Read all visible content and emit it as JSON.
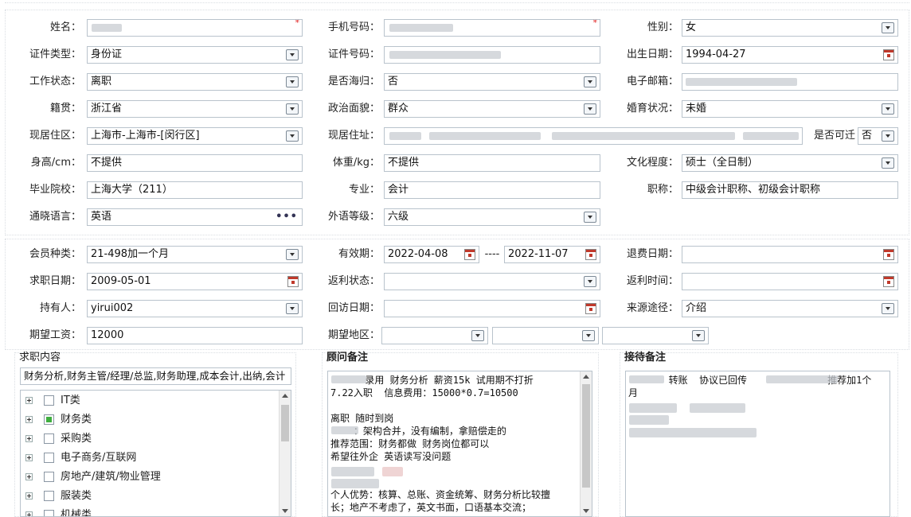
{
  "personal": {
    "name": {
      "label": "姓名："
    },
    "phone": {
      "label": "手机号码："
    },
    "gender": {
      "label": "性别：",
      "value": "女"
    },
    "id_type": {
      "label": "证件类型：",
      "value": "身份证"
    },
    "id_number": {
      "label": "证件号码："
    },
    "birth_date": {
      "label": "出生日期：",
      "value": "1994-04-27"
    },
    "work_status": {
      "label": "工作状态：",
      "value": "离职"
    },
    "returnee": {
      "label": "是否海归：",
      "value": "否"
    },
    "email": {
      "label": "电子邮箱："
    },
    "native_place": {
      "label": "籍贯：",
      "value": "浙江省"
    },
    "political": {
      "label": "政治面貌：",
      "value": "群众"
    },
    "marital": {
      "label": "婚育状况：",
      "value": "未婚"
    },
    "residence_area": {
      "label": "现居住区：",
      "value": "上海市-上海市-[闵行区]"
    },
    "address": {
      "label": "现居住址："
    },
    "relocate": {
      "label": "是否可迁",
      "value": "否"
    },
    "height": {
      "label": "身高/cm：",
      "value": "不提供"
    },
    "weight": {
      "label": "体重/kg：",
      "value": "不提供"
    },
    "education": {
      "label": "文化程度：",
      "value": "硕士（全日制）"
    },
    "school": {
      "label": "毕业院校：",
      "value": "上海大学（211）"
    },
    "major": {
      "label": "专业：",
      "value": "会计"
    },
    "title": {
      "label": "职称：",
      "value": "中级会计职称、初级会计职称"
    },
    "language": {
      "label": "通晓语言：",
      "value": "英语"
    },
    "language_level": {
      "label": "外语等级：",
      "value": "六级"
    }
  },
  "membership": {
    "member_type": {
      "label": "会员种类：",
      "value": "21-498加一个月"
    },
    "valid_period": {
      "label": "有效期：",
      "start": "2022-04-08",
      "separator": "----",
      "end": "2022-11-07"
    },
    "refund_date": {
      "label": "退费日期："
    },
    "job_date": {
      "label": "求职日期：",
      "value": "2009-05-01"
    },
    "rebate_status": {
      "label": "返利状态："
    },
    "rebate_time": {
      "label": "返利时间："
    },
    "holder": {
      "label": "持有人：",
      "value": "yirui002"
    },
    "visit_date": {
      "label": "回访日期："
    },
    "source": {
      "label": "来源途径：",
      "value": "介绍"
    },
    "salary": {
      "label": "期望工资：",
      "value": "12000"
    },
    "region": {
      "label": "期望地区："
    }
  },
  "job_content": {
    "title": "求职内容",
    "summary": "财务分析,财务主管/经理/总监,财务助理,成本会计,出纳,会计",
    "categories": [
      {
        "label": "IT类",
        "checked": false
      },
      {
        "label": "财务类",
        "checked": true
      },
      {
        "label": "采购类",
        "checked": false
      },
      {
        "label": "电子商务/互联网",
        "checked": false
      },
      {
        "label": "房地产/建筑/物业管理",
        "checked": false
      },
      {
        "label": "服装类",
        "checked": false
      },
      {
        "label": "机械类",
        "checked": false
      }
    ]
  },
  "consultant_notes": {
    "title": "顾问备注",
    "lines": [
      "      录用 财务分析 薪资15k 试用期不打折",
      "7.22入职  信息费用：15000*0.7=10500",
      "",
      "离职 随时到岗",
      "    ：架构合并，没有编制，拿赔偿走的",
      "推荐范围：财务都做 财务岗位都可以",
      "希望往外企 英语读写没问题",
      "",
      "",
      "个人优势：核算、总账、资金统筹、财务分析比较擅",
      "长；地产不考虑了，英文书面，口语基本交流；"
    ]
  },
  "reception_notes": {
    "title": "接待备注",
    "lines": [
      "       转账  协议已回传              推荐加1个",
      "月"
    ]
  },
  "colors": {
    "border": "#b9c3cc",
    "required": "#e02020",
    "checked": "#3fae3f"
  }
}
